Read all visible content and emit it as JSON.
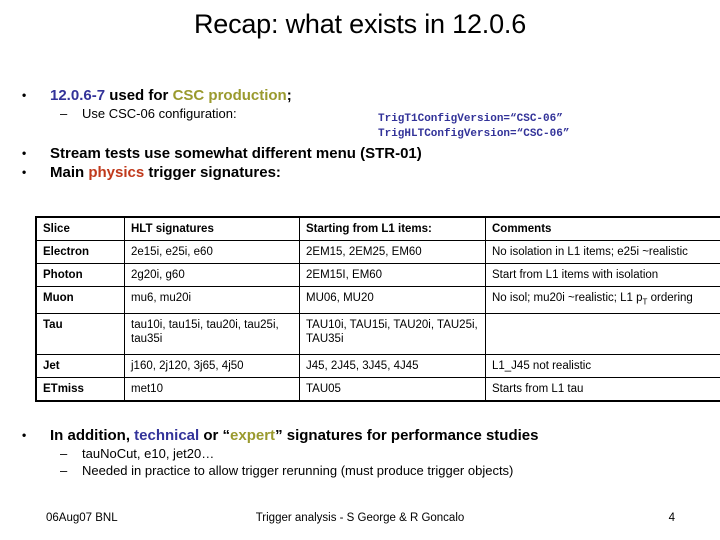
{
  "slide": {
    "title": "Recap: what exists in 12.0.6"
  },
  "bullets": {
    "b1_part1": "12.0.6-7",
    "b1_part2": " used for ",
    "b1_part3": "CSC production",
    "b1_part4": ";",
    "b1_sub1": "Use CSC-06  configuration:",
    "code_line1": "TrigT1ConfigVersion=“CSC-06”",
    "code_line2": "TrigHLTConfigVersion=“CSC-06”",
    "b2": "Stream tests use somewhat different menu (STR-01)",
    "b3_part1": "Main ",
    "b3_part2": "physics",
    "b3_part3": " trigger signatures:",
    "b4_part1": "In addition, ",
    "b4_part2": "technical",
    "b4_part3": " or “",
    "b4_part4": "expert",
    "b4_part5": "” signatures for performance studies",
    "b4_sub1": "tauNoCut, e10, jet20…",
    "b4_sub2": "Needed in practice to allow trigger rerunning (must produce trigger objects)",
    "marker_dot": "•",
    "marker_dash": "–"
  },
  "table": {
    "headers": [
      "Slice",
      "HLT signatures",
      "Starting from L1 items:",
      "Comments"
    ],
    "rows": [
      {
        "slice": "Electron",
        "hlt": "2e15i, e25i, e60",
        "l1": "2EM15, 2EM25, EM60",
        "comments": "No isolation in L1 items; e25i ~realistic"
      },
      {
        "slice": "Photon",
        "hlt": "2g20i, g60",
        "l1": "2EM15I, EM60",
        "comments": "Start from L1 items with isolation"
      },
      {
        "slice": "Muon",
        "hlt": "mu6, mu20i",
        "l1": "MU06, MU20",
        "comments_pre": "No isol; mu20i ~realistic; L1 p",
        "comments_sub": "T",
        "comments_post": " ordering"
      },
      {
        "slice": "Tau",
        "hlt": "tau10i, tau15i, tau20i, tau25i, tau35i",
        "l1": "TAU10i, TAU15i, TAU20i, TAU25i, TAU35i",
        "comments": ""
      },
      {
        "slice": "Jet",
        "hlt": "j160, 2j120, 3j65, 4j50",
        "l1": "J45, 2J45, 3J45, 4J45",
        "comments": "L1_J45 not realistic"
      },
      {
        "slice": "ETmiss",
        "hlt": "met10",
        "l1": "TAU05",
        "comments": "Starts from L1 tau"
      }
    ]
  },
  "footer": {
    "left": "06Aug07 BNL",
    "center": "Trigger analysis - S George & R Goncalo",
    "page": "4"
  },
  "colors": {
    "navy": "#333399",
    "olive": "#9a9a2e",
    "red": "#c0391b",
    "text": "#000000",
    "background": "#ffffff"
  }
}
